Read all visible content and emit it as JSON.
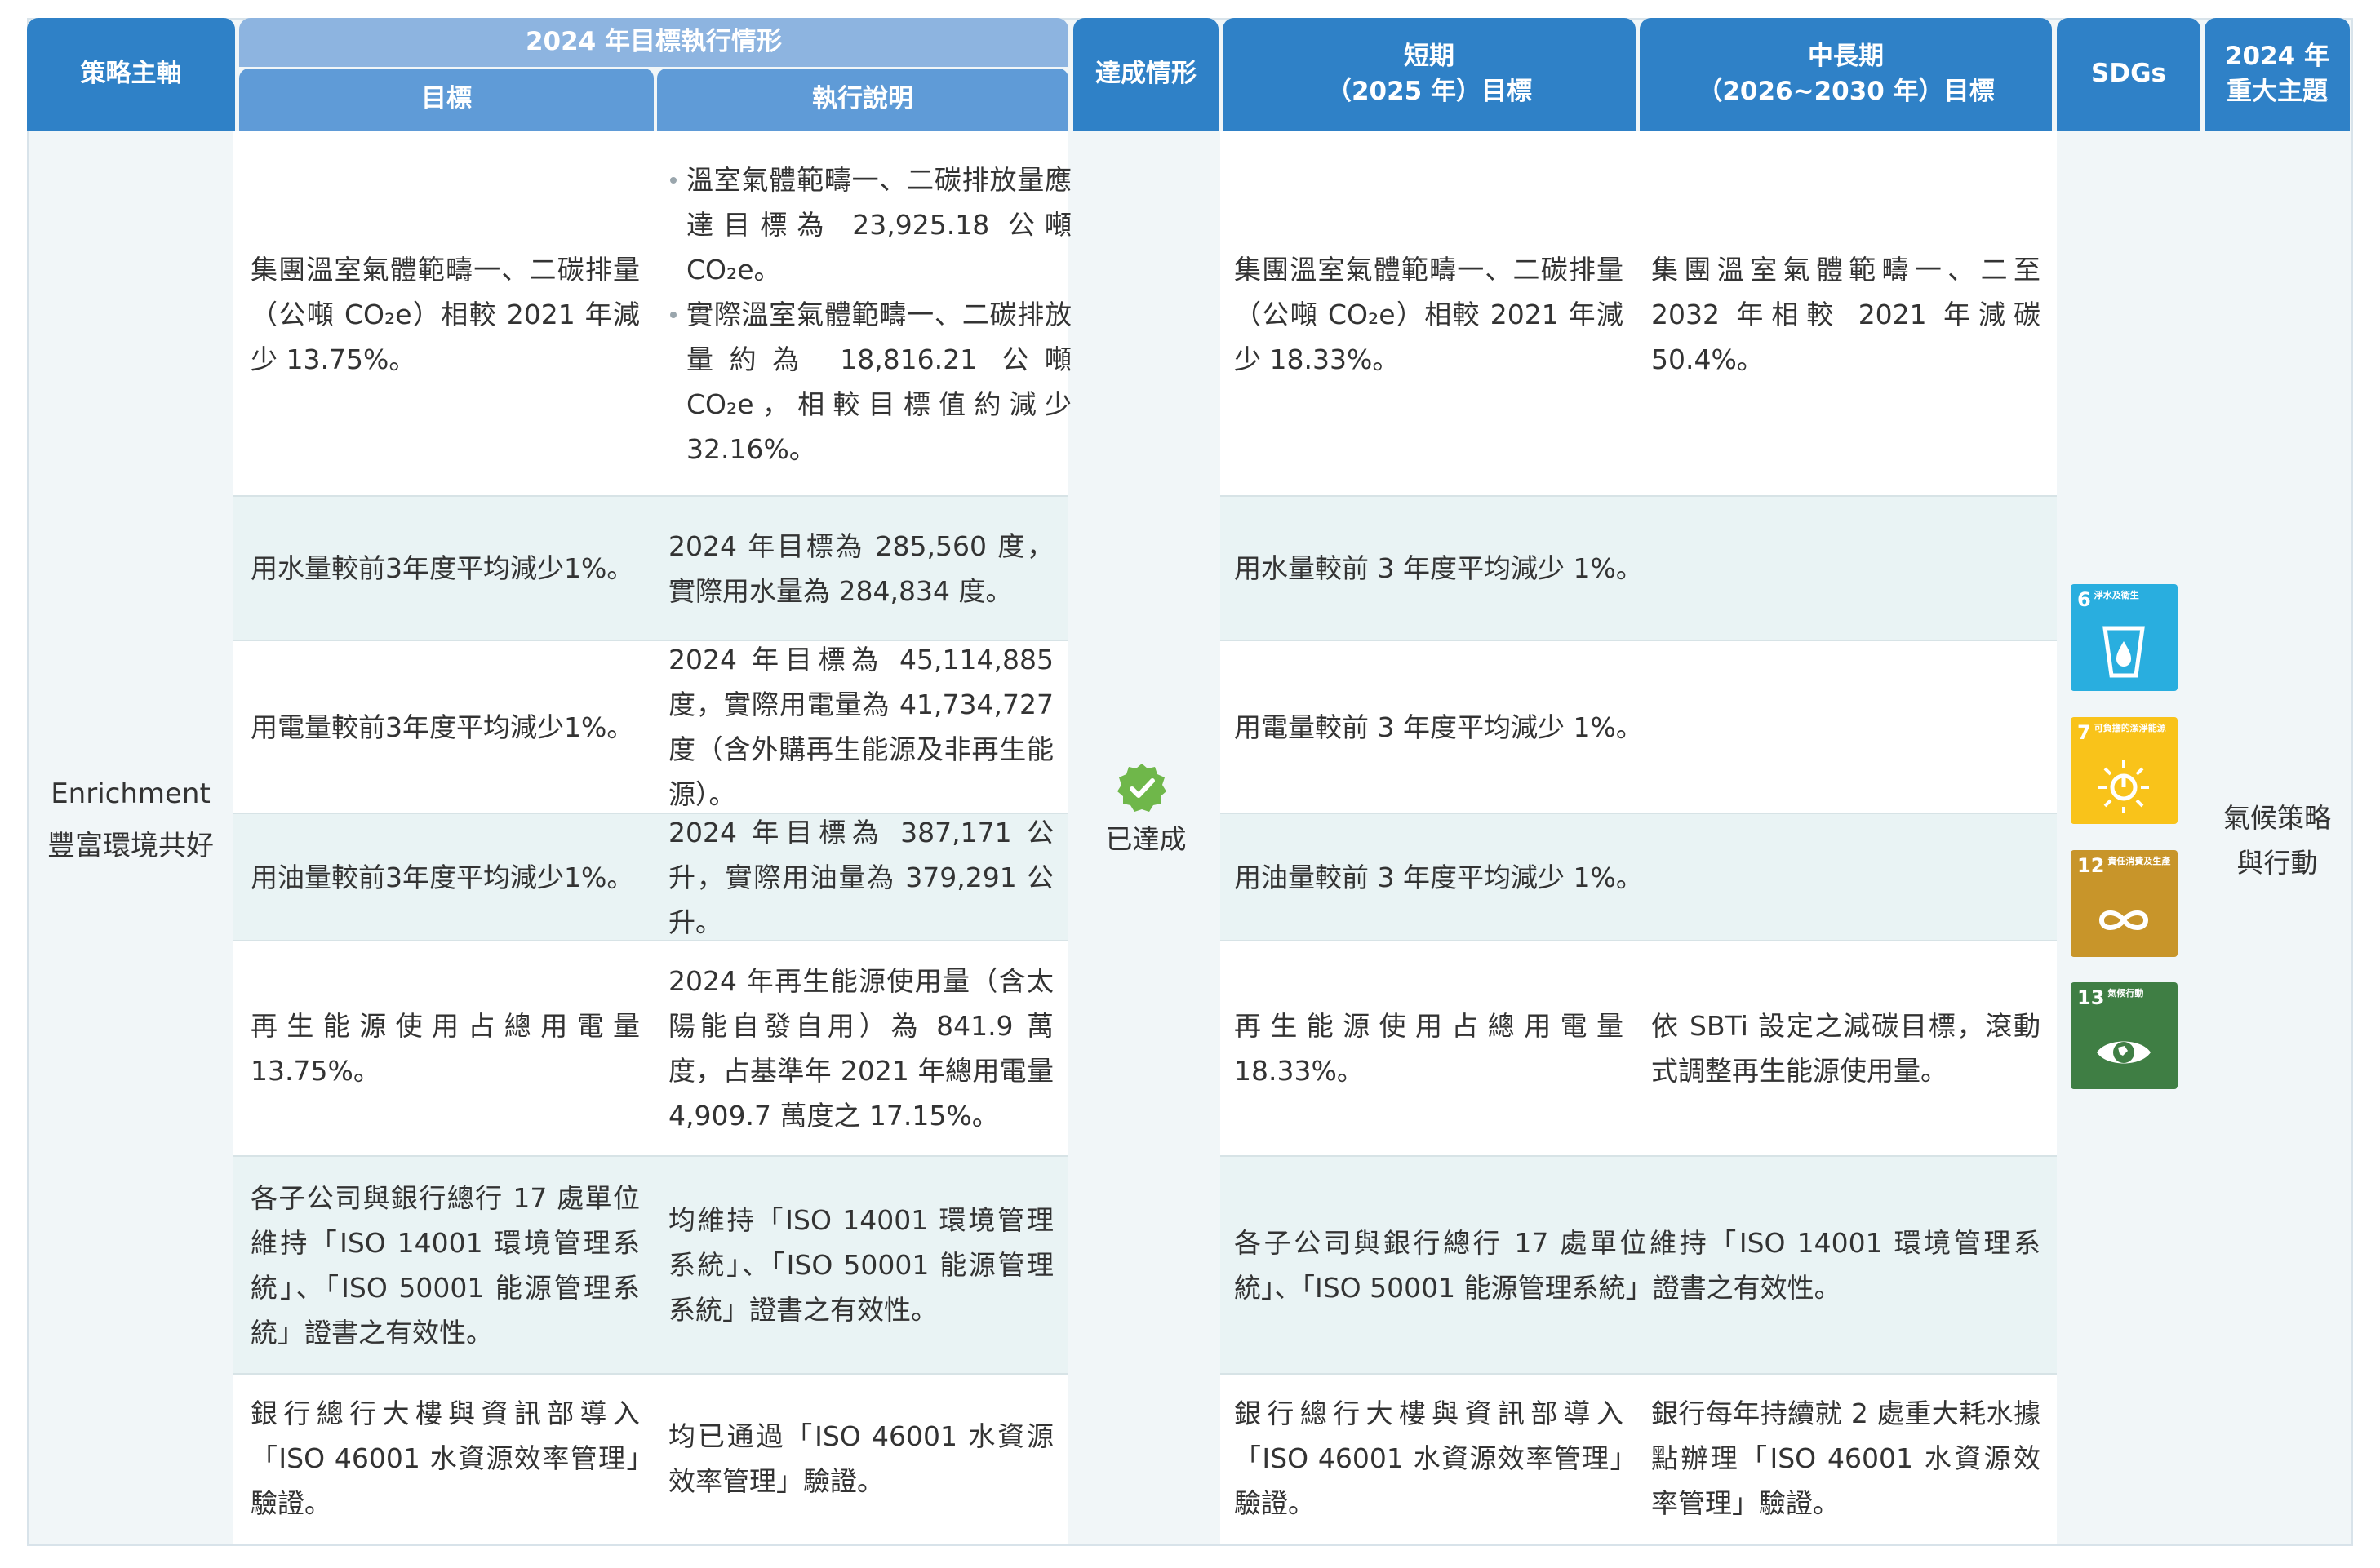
{
  "header": {
    "axis": "策略主軸",
    "group_2024": "2024 年目標執行情形",
    "target": "目標",
    "explain": "執行說明",
    "status": "達成情形",
    "short_l1": "短期",
    "short_l2": "（2025 年）目標",
    "mid_l1": "中長期",
    "mid_l2": "（2026~2030 年）目標",
    "sdgs": "SDGs",
    "topic_l1": "2024 年",
    "topic_l2": "重大主題"
  },
  "axis": {
    "en": "Enrichment",
    "zh": "豐富環境共好"
  },
  "status": {
    "label": "已達成",
    "color": "#6fb74a"
  },
  "topic": {
    "l1": "氣候策略",
    "l2": "與行動"
  },
  "rows": [
    {
      "target": "集團溫室氣體範疇一、二碳排量（公噸 CO₂e）相較 2021 年減少 13.75%。",
      "explain_1": "溫室氣體範疇一、二碳排放量應達目標為 23,925.18 公噸 CO₂e。",
      "explain_2": "實際溫室氣體範疇一、二碳排放量約為 18,816.21 公噸 CO₂e，相較目標值約減少 32.16%。",
      "short": "集團溫室氣體範疇一、二碳排量（公噸 CO₂e）相較 2021 年減少 18.33%。",
      "mid": "集團溫室氣體範疇一、二至 2032 年相較 2021 年減碳 50.4%。"
    },
    {
      "target": "用水量較前3年度平均減少1%。",
      "explain": "2024 年目標為 285,560 度，實際用水量為 284,834 度。",
      "short": "用水量較前 3 年度平均減少 1%。"
    },
    {
      "target": "用電量較前3年度平均減少1%。",
      "explain": "2024 年目標為 45,114,885 度，實際用電量為 41,734,727 度（含外購再生能源及非再生能源）。",
      "short": "用電量較前 3 年度平均減少 1%。"
    },
    {
      "target": "用油量較前3年度平均減少1%。",
      "explain": "2024 年目標為 387,171 公升，實際用油量為 379,291 公升。",
      "short": "用油量較前 3 年度平均減少 1%。"
    },
    {
      "target": "再生能源使用占總用電量 13.75%。",
      "explain": "2024 年再生能源使用量（含太陽能自發自用）為 841.9 萬度，占基準年 2021 年總用電量 4,909.7 萬度之 17.15%。",
      "short": "再生能源使用占總用電量 18.33%。",
      "mid": "依 SBTi 設定之減碳目標，滾動式調整再生能源使用量。"
    },
    {
      "target": "各子公司與銀行總行 17 處單位維持「ISO 14001 環境管理系統」、「ISO 50001 能源管理系統」證書之有效性。",
      "explain": "均維持「ISO 14001 環境管理系統」、「ISO 50001 能源管理系統」證書之有效性。",
      "short_mid": "各子公司與銀行總行 17 處單位維持「ISO 14001 環境管理系統」、「ISO 50001 能源管理系統」證書之有效性。"
    },
    {
      "target": "銀行總行大樓與資訊部導入「ISO 46001 水資源效率管理」驗證。",
      "explain": "均已通過「ISO 46001 水資源效率管理」驗證。",
      "short": "銀行總行大樓與資訊部導入「ISO 46001 水資源效率管理」驗證。",
      "mid": "銀行每年持續就 2 處重大耗水據點辦理「ISO 46001 水資源效率管理」驗證。"
    }
  ],
  "sdgs": [
    {
      "num": "6",
      "label": "淨水及衛生",
      "color": "#29aedf",
      "icon": "water-drop-glass-icon"
    },
    {
      "num": "7",
      "label": "可負擔的潔淨能源",
      "color": "#f9c31a",
      "icon": "sun-power-icon"
    },
    {
      "num": "12",
      "label": "責任消費及生產",
      "color": "#c8952a",
      "icon": "infinity-icon"
    },
    {
      "num": "13",
      "label": "氣候行動",
      "color": "#3f7e44",
      "icon": "eye-globe-icon"
    }
  ]
}
